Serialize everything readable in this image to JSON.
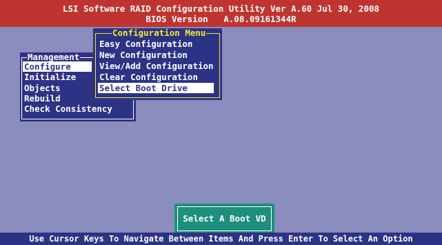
{
  "header": {
    "line1": "LSI Software RAID Configuration Utility Ver A.60 Jul 30, 2008",
    "line2": "BIOS Version   A.08.09161344R"
  },
  "management_menu": {
    "title": "Management",
    "items": [
      "Configure",
      "Initialize",
      "Objects",
      "Rebuild",
      "Check Consistency"
    ],
    "selected": "Configure"
  },
  "configuration_menu": {
    "title": "Configuration Menu",
    "items": [
      "Easy Configuration",
      "New Configuration",
      "View/Add Configuration",
      "Clear Configuration",
      "Select Boot Drive"
    ],
    "selected": "Select Boot Drive"
  },
  "status_box": {
    "text": "Select A Boot VD"
  },
  "footer": {
    "text": "Use Cursor Keys To Navigate Between Items And Press Enter To Select An Option"
  },
  "colors": {
    "header_bg": "#bf3430",
    "screen_bg": "#8a8dbd",
    "menu_bg": "#2d3384",
    "menu_title_accent": "#f2e82e",
    "status_bg": "#1e8f7c"
  }
}
